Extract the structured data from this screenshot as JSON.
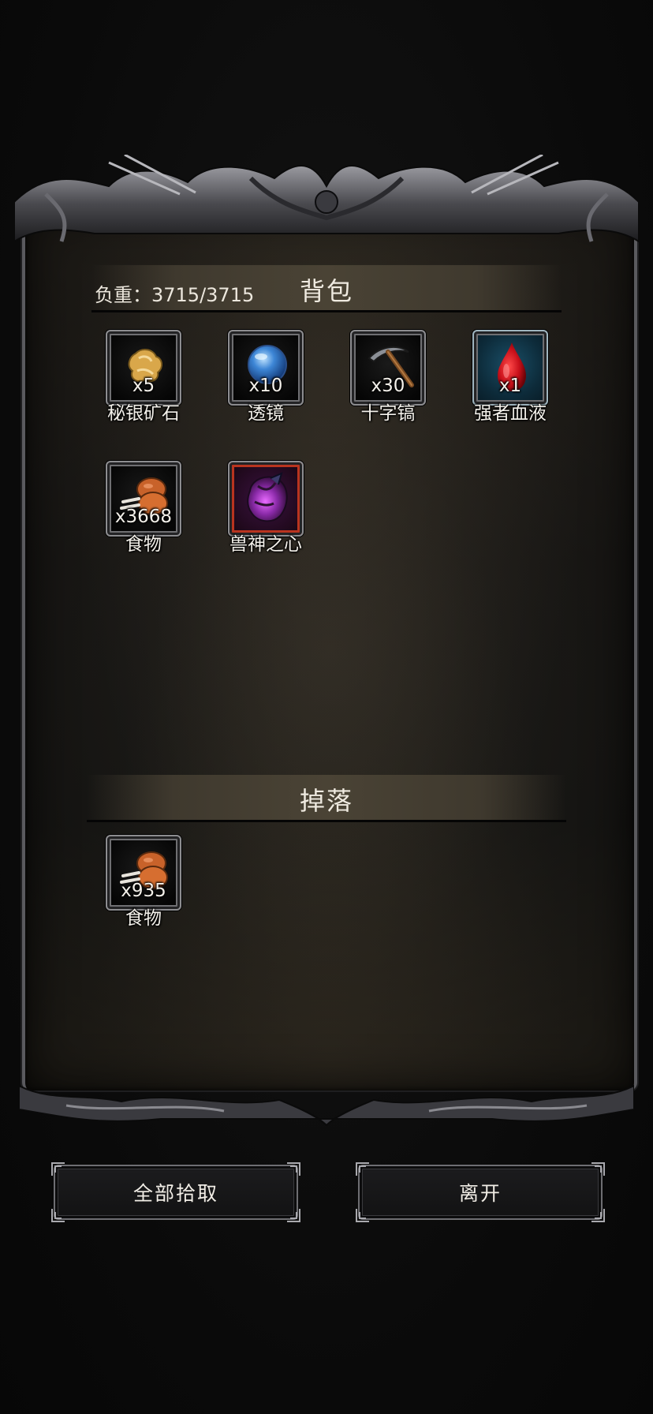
{
  "backpack": {
    "title": "背包",
    "weight_text": "负重：3715/3715",
    "items": [
      {
        "name": "秘银矿石",
        "qty": "x5",
        "icon": "mithril-ore-icon"
      },
      {
        "name": "透镜",
        "qty": "x10",
        "icon": "lens-icon"
      },
      {
        "name": "十字镐",
        "qty": "x30",
        "icon": "pickaxe-icon"
      },
      {
        "name": "强者血液",
        "qty": "x1",
        "icon": "blood-drop-icon"
      },
      {
        "name": "食物",
        "qty": "x3668",
        "icon": "meat-icon"
      },
      {
        "name": "兽神之心",
        "qty": "",
        "icon": "beast-god-heart-icon"
      }
    ]
  },
  "drops": {
    "title": "掉落",
    "items": [
      {
        "name": "食物",
        "qty": "x935",
        "icon": "meat-icon"
      }
    ]
  },
  "buttons": {
    "pickup_all": "全部拾取",
    "leave": "离开"
  },
  "colors": {
    "panel": "#1e1c19",
    "header_bar": "#4a4335",
    "rare_slot": "#1a4e66",
    "epic_slot_border": "#b9341f"
  }
}
